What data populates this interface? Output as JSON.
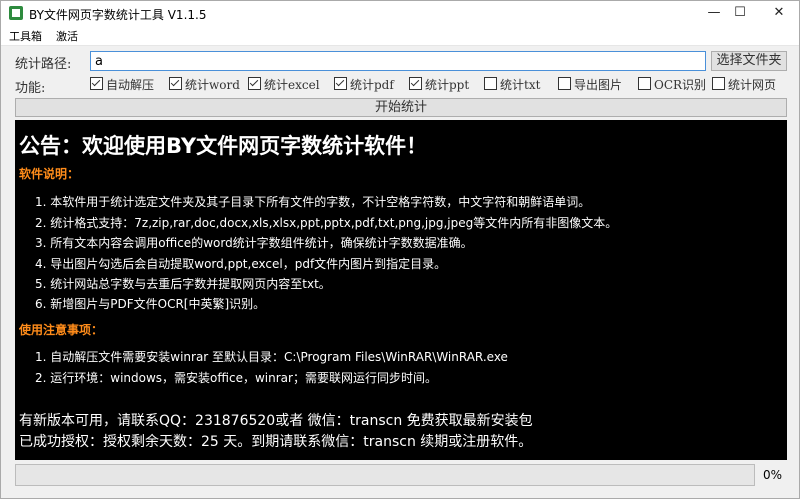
{
  "window": {
    "title": "BY文件网页字数统计工具 V1.1.5",
    "min_glyph": "—",
    "max_glyph": "☐",
    "close_glyph": "✕"
  },
  "menu": {
    "items": [
      "工具箱",
      "激活"
    ]
  },
  "path": {
    "label": "统计路径:",
    "value": "a",
    "browse_button": "选择文件夹"
  },
  "options": {
    "label": "功能:",
    "items": [
      {
        "label": "自动解压",
        "checked": true
      },
      {
        "label": "统计word",
        "checked": true
      },
      {
        "label": "统计excel",
        "checked": true
      },
      {
        "label": "统计pdf",
        "checked": true
      },
      {
        "label": "统计ppt",
        "checked": true
      },
      {
        "label": "统计txt",
        "checked": false
      },
      {
        "label": "导出图片",
        "checked": false
      },
      {
        "label": "OCR识别",
        "checked": false
      },
      {
        "label": "统计网页",
        "checked": false
      }
    ]
  },
  "start_button": "开始统计",
  "console": {
    "notice": "公告：欢迎使用BY文件网页字数统计软件！",
    "intro_heading": "软件说明：",
    "intro_lines": [
      "1. 本软件用于统计选定文件夹及其子目录下所有文件的字数，不计空格字符数，中文字符和朝鲜语单词。",
      "2. 统计格式支持：7z,zip,rar,doc,docx,xls,xlsx,ppt,pptx,pdf,txt,png,jpg,jpeg等文件内所有非图像文本。",
      "3. 所有文本内容会调用office的word统计字数组件统计，确保统计字数数据准确。",
      "4. 导出图片勾选后会自动提取word,ppt,excel，pdf文件内图片到指定目录。",
      "5. 统计网站总字数与去重后字数并提取网页内容至txt。",
      "6. 新增图片与PDF文件OCR[中英繁]识别。"
    ],
    "notes_heading": "使用注意事项：",
    "notes_lines": [
      "1. 自动解压文件需要安装winrar 至默认目录：C:\\Program Files\\WinRAR\\WinRAR.exe",
      "2. 运行环境：windows，需安装office，winrar；需要联网运行同步时间。"
    ],
    "footer": [
      "有新版本可用，请联系QQ：231876520或者 微信：transcn 免费获取最新安装包",
      "已成功授权：授权剩余天数：25 天。到期请联系微信：transcn 续期或注册软件。"
    ]
  },
  "progress": {
    "value": 0,
    "label": "0%"
  },
  "colors": {
    "accent": "#ff8c1a",
    "console_bg": "#000000",
    "focus_border": "#4a90d9"
  }
}
